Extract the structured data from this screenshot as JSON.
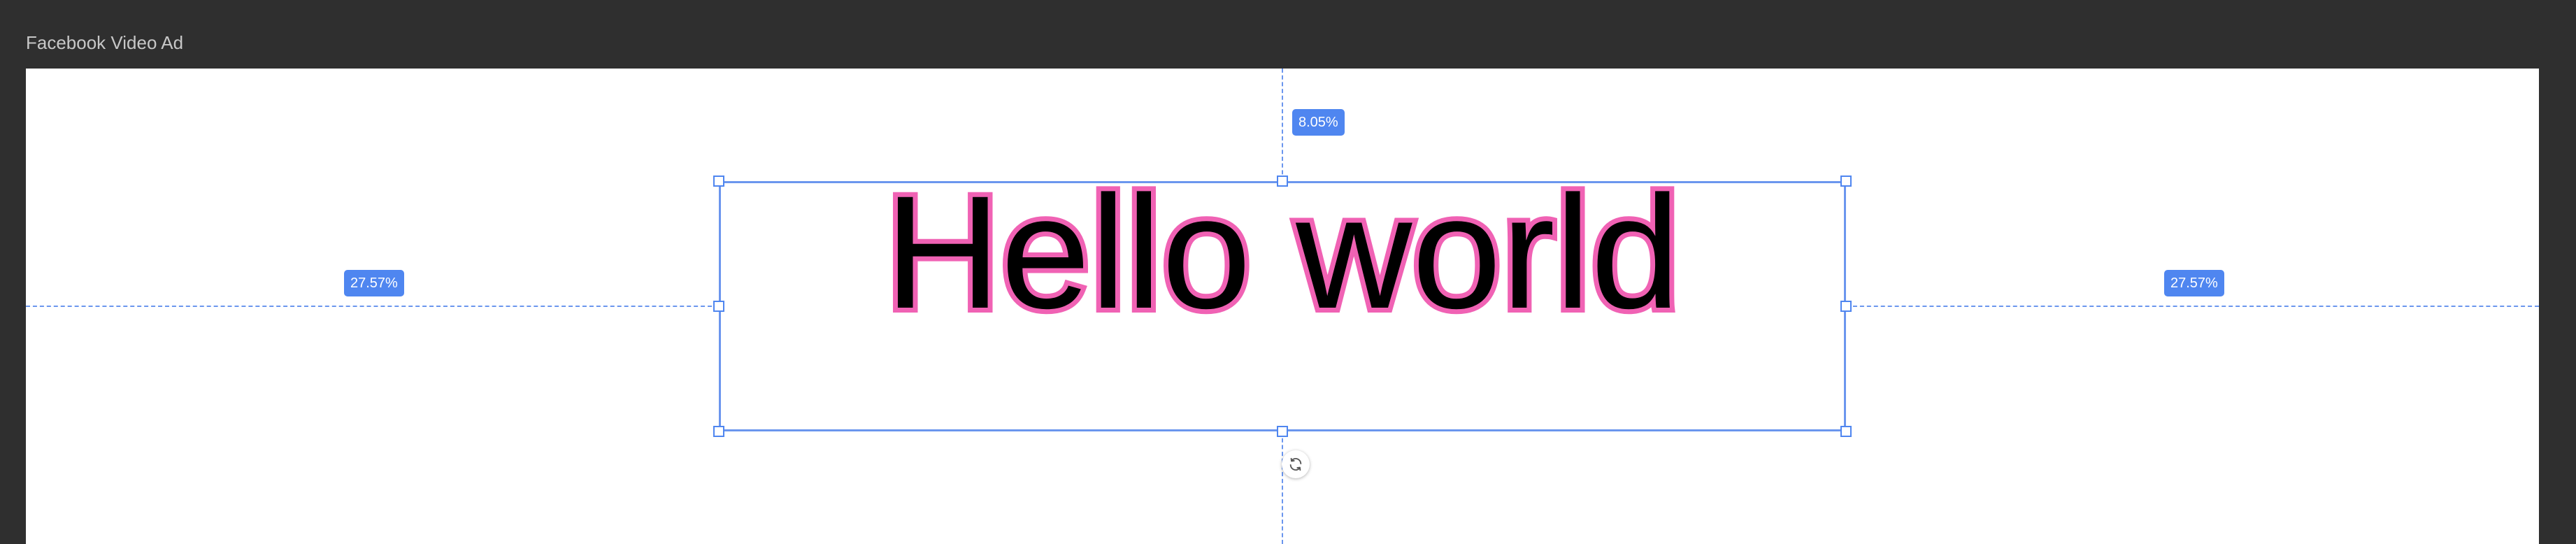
{
  "project": {
    "title": "Facebook Video Ad"
  },
  "canvas": {
    "text_element": {
      "text": "Hello world",
      "fill_color": "#000000",
      "stroke_color": "#f062b4"
    },
    "guides": {
      "top_label": "8.05%",
      "left_label": "27.57%",
      "right_label": "27.57%"
    }
  },
  "icons": {
    "rotate": "rotate-icon"
  },
  "colors": {
    "accent": "#4f86f0",
    "background": "#2f2f2f",
    "canvas": "#ffffff"
  }
}
